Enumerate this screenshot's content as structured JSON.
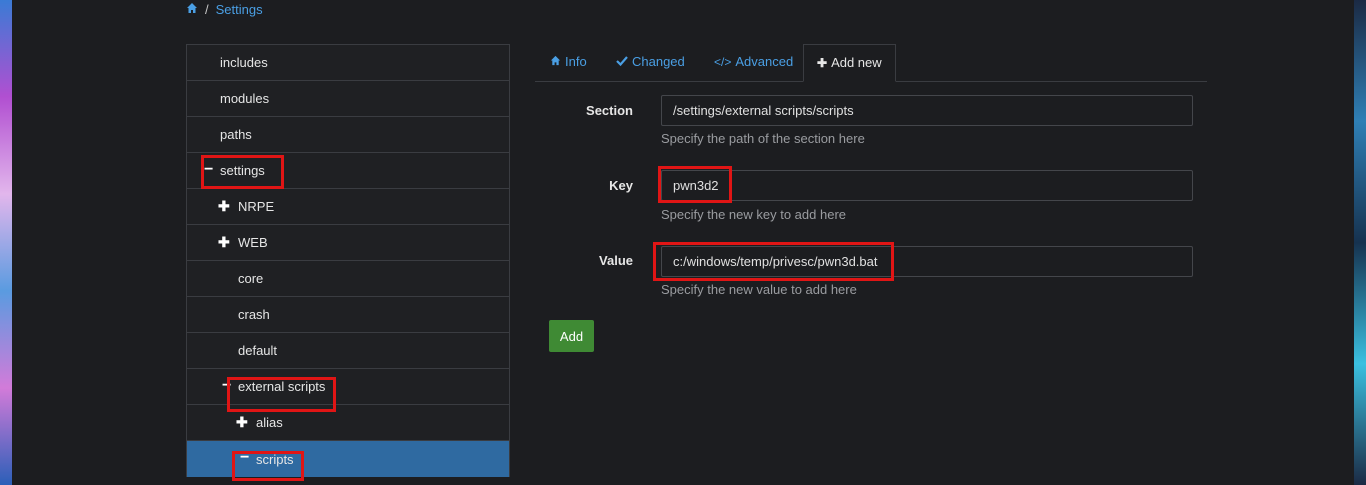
{
  "breadcrumb": {
    "separator": "/",
    "current": "Settings"
  },
  "tree": {
    "items": [
      {
        "label": "includes",
        "toggle": ""
      },
      {
        "label": "modules",
        "toggle": ""
      },
      {
        "label": "paths",
        "toggle": ""
      },
      {
        "label": "settings",
        "toggle": "−"
      },
      {
        "label": "NRPE",
        "toggle": "✚"
      },
      {
        "label": "WEB",
        "toggle": "✚"
      },
      {
        "label": "core",
        "toggle": ""
      },
      {
        "label": "crash",
        "toggle": ""
      },
      {
        "label": "default",
        "toggle": ""
      },
      {
        "label": "external scripts",
        "toggle": "−"
      },
      {
        "label": "alias",
        "toggle": "✚"
      },
      {
        "label": "scripts",
        "toggle": "−"
      }
    ]
  },
  "tabs": {
    "info": "Info",
    "changed": "Changed",
    "advanced": "Advanced",
    "add_new": "Add new"
  },
  "form": {
    "section_label": "Section",
    "section_value": "/settings/external scripts/scripts",
    "section_help": "Specify the path of the section here",
    "key_label": "Key",
    "key_value": "pwn3d2",
    "key_help": "Specify the new key to add here",
    "value_label": "Value",
    "value_value": "c:/windows/temp/privesc/pwn3d.bat",
    "value_help": "Specify the new value to add here",
    "add_label": "Add"
  },
  "colors": {
    "background": "#1c1d20",
    "link": "#4a9fe4",
    "selected": "#2f6aa1",
    "add_button": "#3f8a34",
    "highlight": "#e01515"
  }
}
